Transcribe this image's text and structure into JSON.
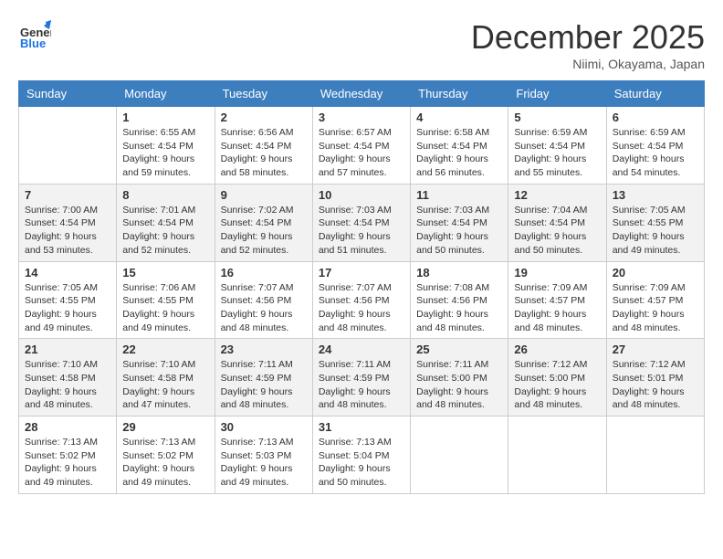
{
  "header": {
    "logo_line1": "General",
    "logo_line2": "Blue",
    "month_title": "December 2025",
    "subtitle": "Niimi, Okayama, Japan"
  },
  "weekdays": [
    "Sunday",
    "Monday",
    "Tuesday",
    "Wednesday",
    "Thursday",
    "Friday",
    "Saturday"
  ],
  "weeks": [
    [
      {
        "day": "",
        "sunrise": "",
        "sunset": "",
        "daylight": ""
      },
      {
        "day": "1",
        "sunrise": "Sunrise: 6:55 AM",
        "sunset": "Sunset: 4:54 PM",
        "daylight": "Daylight: 9 hours and 59 minutes."
      },
      {
        "day": "2",
        "sunrise": "Sunrise: 6:56 AM",
        "sunset": "Sunset: 4:54 PM",
        "daylight": "Daylight: 9 hours and 58 minutes."
      },
      {
        "day": "3",
        "sunrise": "Sunrise: 6:57 AM",
        "sunset": "Sunset: 4:54 PM",
        "daylight": "Daylight: 9 hours and 57 minutes."
      },
      {
        "day": "4",
        "sunrise": "Sunrise: 6:58 AM",
        "sunset": "Sunset: 4:54 PM",
        "daylight": "Daylight: 9 hours and 56 minutes."
      },
      {
        "day": "5",
        "sunrise": "Sunrise: 6:59 AM",
        "sunset": "Sunset: 4:54 PM",
        "daylight": "Daylight: 9 hours and 55 minutes."
      },
      {
        "day": "6",
        "sunrise": "Sunrise: 6:59 AM",
        "sunset": "Sunset: 4:54 PM",
        "daylight": "Daylight: 9 hours and 54 minutes."
      }
    ],
    [
      {
        "day": "7",
        "sunrise": "Sunrise: 7:00 AM",
        "sunset": "Sunset: 4:54 PM",
        "daylight": "Daylight: 9 hours and 53 minutes."
      },
      {
        "day": "8",
        "sunrise": "Sunrise: 7:01 AM",
        "sunset": "Sunset: 4:54 PM",
        "daylight": "Daylight: 9 hours and 52 minutes."
      },
      {
        "day": "9",
        "sunrise": "Sunrise: 7:02 AM",
        "sunset": "Sunset: 4:54 PM",
        "daylight": "Daylight: 9 hours and 52 minutes."
      },
      {
        "day": "10",
        "sunrise": "Sunrise: 7:03 AM",
        "sunset": "Sunset: 4:54 PM",
        "daylight": "Daylight: 9 hours and 51 minutes."
      },
      {
        "day": "11",
        "sunrise": "Sunrise: 7:03 AM",
        "sunset": "Sunset: 4:54 PM",
        "daylight": "Daylight: 9 hours and 50 minutes."
      },
      {
        "day": "12",
        "sunrise": "Sunrise: 7:04 AM",
        "sunset": "Sunset: 4:54 PM",
        "daylight": "Daylight: 9 hours and 50 minutes."
      },
      {
        "day": "13",
        "sunrise": "Sunrise: 7:05 AM",
        "sunset": "Sunset: 4:55 PM",
        "daylight": "Daylight: 9 hours and 49 minutes."
      }
    ],
    [
      {
        "day": "14",
        "sunrise": "Sunrise: 7:05 AM",
        "sunset": "Sunset: 4:55 PM",
        "daylight": "Daylight: 9 hours and 49 minutes."
      },
      {
        "day": "15",
        "sunrise": "Sunrise: 7:06 AM",
        "sunset": "Sunset: 4:55 PM",
        "daylight": "Daylight: 9 hours and 49 minutes."
      },
      {
        "day": "16",
        "sunrise": "Sunrise: 7:07 AM",
        "sunset": "Sunset: 4:56 PM",
        "daylight": "Daylight: 9 hours and 48 minutes."
      },
      {
        "day": "17",
        "sunrise": "Sunrise: 7:07 AM",
        "sunset": "Sunset: 4:56 PM",
        "daylight": "Daylight: 9 hours and 48 minutes."
      },
      {
        "day": "18",
        "sunrise": "Sunrise: 7:08 AM",
        "sunset": "Sunset: 4:56 PM",
        "daylight": "Daylight: 9 hours and 48 minutes."
      },
      {
        "day": "19",
        "sunrise": "Sunrise: 7:09 AM",
        "sunset": "Sunset: 4:57 PM",
        "daylight": "Daylight: 9 hours and 48 minutes."
      },
      {
        "day": "20",
        "sunrise": "Sunrise: 7:09 AM",
        "sunset": "Sunset: 4:57 PM",
        "daylight": "Daylight: 9 hours and 48 minutes."
      }
    ],
    [
      {
        "day": "21",
        "sunrise": "Sunrise: 7:10 AM",
        "sunset": "Sunset: 4:58 PM",
        "daylight": "Daylight: 9 hours and 48 minutes."
      },
      {
        "day": "22",
        "sunrise": "Sunrise: 7:10 AM",
        "sunset": "Sunset: 4:58 PM",
        "daylight": "Daylight: 9 hours and 47 minutes."
      },
      {
        "day": "23",
        "sunrise": "Sunrise: 7:11 AM",
        "sunset": "Sunset: 4:59 PM",
        "daylight": "Daylight: 9 hours and 48 minutes."
      },
      {
        "day": "24",
        "sunrise": "Sunrise: 7:11 AM",
        "sunset": "Sunset: 4:59 PM",
        "daylight": "Daylight: 9 hours and 48 minutes."
      },
      {
        "day": "25",
        "sunrise": "Sunrise: 7:11 AM",
        "sunset": "Sunset: 5:00 PM",
        "daylight": "Daylight: 9 hours and 48 minutes."
      },
      {
        "day": "26",
        "sunrise": "Sunrise: 7:12 AM",
        "sunset": "Sunset: 5:00 PM",
        "daylight": "Daylight: 9 hours and 48 minutes."
      },
      {
        "day": "27",
        "sunrise": "Sunrise: 7:12 AM",
        "sunset": "Sunset: 5:01 PM",
        "daylight": "Daylight: 9 hours and 48 minutes."
      }
    ],
    [
      {
        "day": "28",
        "sunrise": "Sunrise: 7:13 AM",
        "sunset": "Sunset: 5:02 PM",
        "daylight": "Daylight: 9 hours and 49 minutes."
      },
      {
        "day": "29",
        "sunrise": "Sunrise: 7:13 AM",
        "sunset": "Sunset: 5:02 PM",
        "daylight": "Daylight: 9 hours and 49 minutes."
      },
      {
        "day": "30",
        "sunrise": "Sunrise: 7:13 AM",
        "sunset": "Sunset: 5:03 PM",
        "daylight": "Daylight: 9 hours and 49 minutes."
      },
      {
        "day": "31",
        "sunrise": "Sunrise: 7:13 AM",
        "sunset": "Sunset: 5:04 PM",
        "daylight": "Daylight: 9 hours and 50 minutes."
      },
      {
        "day": "",
        "sunrise": "",
        "sunset": "",
        "daylight": ""
      },
      {
        "day": "",
        "sunrise": "",
        "sunset": "",
        "daylight": ""
      },
      {
        "day": "",
        "sunrise": "",
        "sunset": "",
        "daylight": ""
      }
    ]
  ]
}
